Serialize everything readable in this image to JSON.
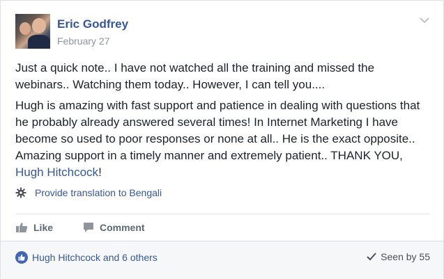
{
  "post": {
    "author": "Eric Godfrey",
    "date": "February 27",
    "paragraph1": "Just a quick note.. I have not watched all the training and missed the webinars.. Watching them today.. However, I can tell you....",
    "paragraph2_text": "Hugh is amazing with fast support and patience in dealing with questions that he probably already answered several times! In Internet Marketing I have become so used to poor responses or none at all.. He is the exact opposite.. Amazing support in a timely manner and extremely patient.. THANK YOU, ",
    "paragraph2_mention": "Hugh Hitchcock",
    "paragraph2_end": "!",
    "translation_link": "Provide translation to Bengali"
  },
  "actions": {
    "like_label": "Like",
    "comment_label": "Comment"
  },
  "footer": {
    "reactions_text": "Hugh Hitchcock and 6 others",
    "seen_text": "Seen by 55"
  },
  "icons": {
    "options": "chevron-down-icon",
    "translate": "gear-icon",
    "like": "thumbs-up-icon",
    "comment": "comment-bubble-icon",
    "reaction": "like-reaction-icon",
    "seen": "checkmark-icon"
  },
  "colors": {
    "link": "#365899",
    "muted": "#90949c",
    "action": "#606770",
    "like_badge": "#4267b2"
  }
}
